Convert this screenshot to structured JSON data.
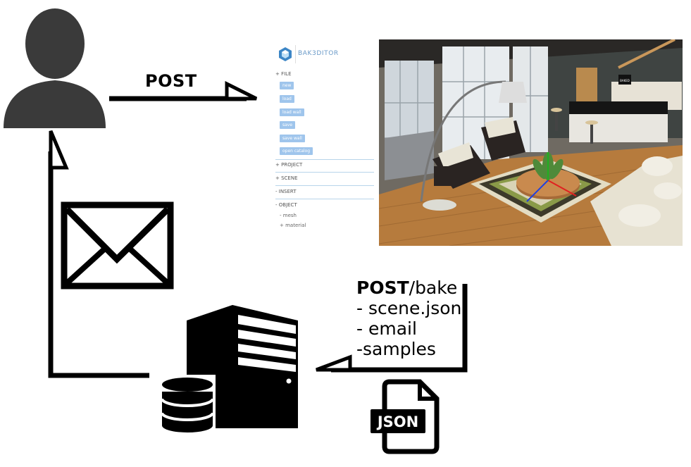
{
  "top_arrow_label": "POST",
  "bake_request": {
    "method": "POST",
    "path": "/bake",
    "items": [
      "- scene.json",
      "- email",
      "-samples"
    ]
  },
  "json_file_label": "JSON",
  "editor": {
    "logo_text": "BAK3DITOR",
    "file_header": "+ FILE",
    "file_buttons": [
      "new",
      "load",
      "load wall",
      "save",
      "save wall",
      "open catalog"
    ],
    "project_header": "+ PROJECT",
    "scene_header": "+ SCENE",
    "insert_header": "- INSERT",
    "object_header": "- OBJECT",
    "object_items": [
      "- mesh",
      "+ material"
    ]
  },
  "scene_sign_text": "BAKED",
  "colors": {
    "icon_dark": "#3a3a3a",
    "black": "#000000",
    "editor_button": "#9fc5ec",
    "editor_accent": "#6a9ac8"
  }
}
